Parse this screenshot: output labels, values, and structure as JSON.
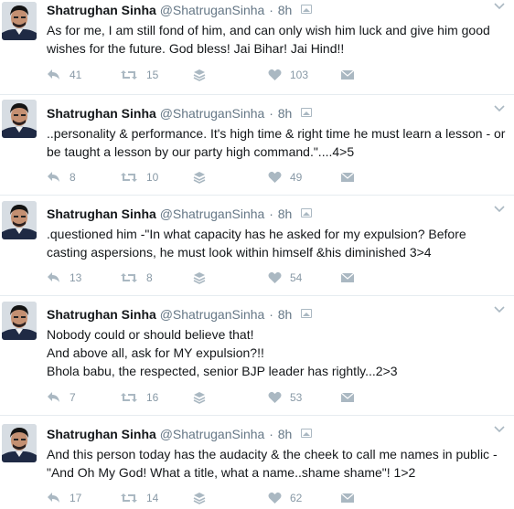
{
  "colors": {
    "text": "#14171a",
    "muted": "#657786",
    "icon": "#aab8c2",
    "divider": "#e6ecf0"
  },
  "icons": {
    "reply": "reply-icon",
    "retweet": "retweet-icon",
    "stack": "stack-icon",
    "like": "heart-icon",
    "message": "envelope-icon",
    "menu": "chevron-down-icon"
  },
  "tweets": [
    {
      "author": "Shatrughan Sinha",
      "handle": "@ShatruganSinha",
      "separator": "·",
      "time": "8h",
      "lines": [
        "As for me, I am still fond of him, and can only wish him luck and give him good",
        "wishes for the future. God bless! Jai Bihar! Jai Hind!!"
      ],
      "replies": "41",
      "retweets": "15",
      "likes": "103"
    },
    {
      "author": "Shatrughan Sinha",
      "handle": "@ShatruganSinha",
      "separator": "·",
      "time": "8h",
      "lines": [
        "..personality & performance. It's high time & right time he must learn a lesson - or",
        "be taught a lesson by our party high command.\"....4>5"
      ],
      "replies": "8",
      "retweets": "10",
      "likes": "49"
    },
    {
      "author": "Shatrughan Sinha",
      "handle": "@ShatruganSinha",
      "separator": "·",
      "time": "8h",
      "lines": [
        ".questioned him -\"In what capacity has he asked for my expulsion? Before",
        "casting aspersions, he must look within himself &his diminished 3>4"
      ],
      "replies": "13",
      "retweets": "8",
      "likes": "54"
    },
    {
      "author": "Shatrughan Sinha",
      "handle": "@ShatruganSinha",
      "separator": "·",
      "time": "8h",
      "lines": [
        "Nobody could or should believe that!",
        "And above all, ask for MY expulsion?!!",
        "Bhola babu, the respected, senior BJP leader has rightly...2>3"
      ],
      "replies": "7",
      "retweets": "16",
      "likes": "53"
    },
    {
      "author": "Shatrughan Sinha",
      "handle": "@ShatruganSinha",
      "separator": "·",
      "time": "8h",
      "lines": [
        "And this person today has the audacity & the cheek to call me names in public -",
        "\"And Oh My God! What a title, what a name..shame shame\"! 1>2"
      ],
      "replies": "17",
      "retweets": "14",
      "likes": "62"
    }
  ]
}
